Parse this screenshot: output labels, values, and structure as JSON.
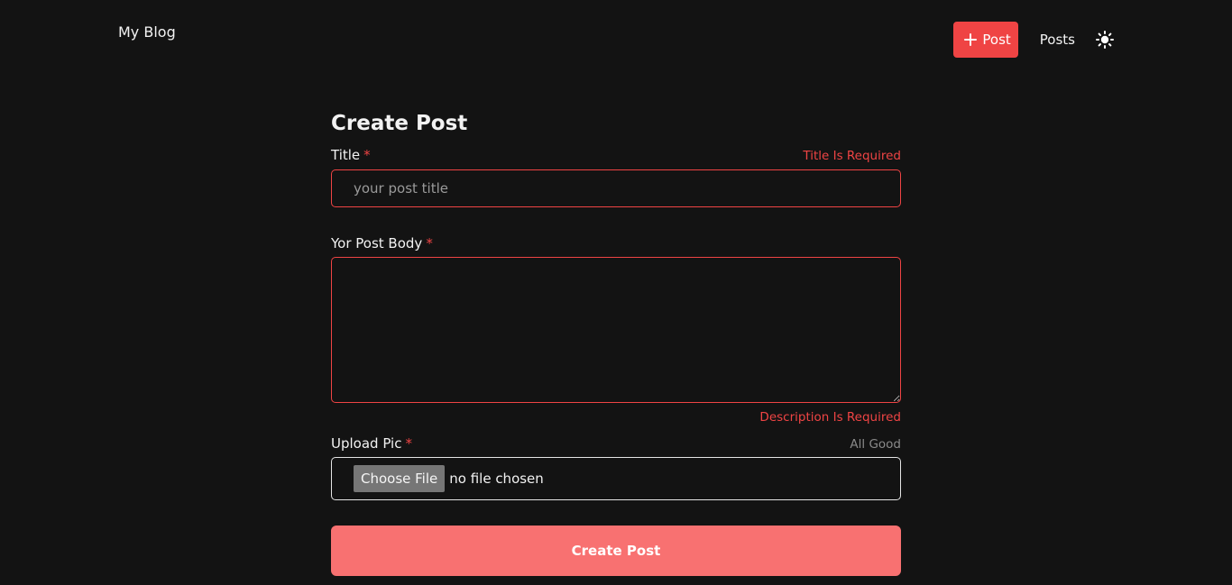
{
  "header": {
    "brand": "My Blog",
    "new_post_label": "Post",
    "posts_link": "Posts",
    "theme_icon": "sun-icon"
  },
  "form": {
    "heading": "Create Post",
    "required_mark": "*",
    "title_field": {
      "label": "Title",
      "placeholder": "your post title",
      "value": "",
      "error": "Title Is Required"
    },
    "body_field": {
      "label": "Yor Post Body",
      "value": "",
      "error": "Description Is Required"
    },
    "upload_field": {
      "label": "Upload Pic",
      "status_message": "All Good",
      "button_label": "Choose File",
      "file_status": "no file chosen"
    },
    "submit_label": "Create Post"
  },
  "colors": {
    "background": "#131313",
    "accent": "#ef4444",
    "submit_button": "#f87171",
    "file_button": "#767676"
  }
}
